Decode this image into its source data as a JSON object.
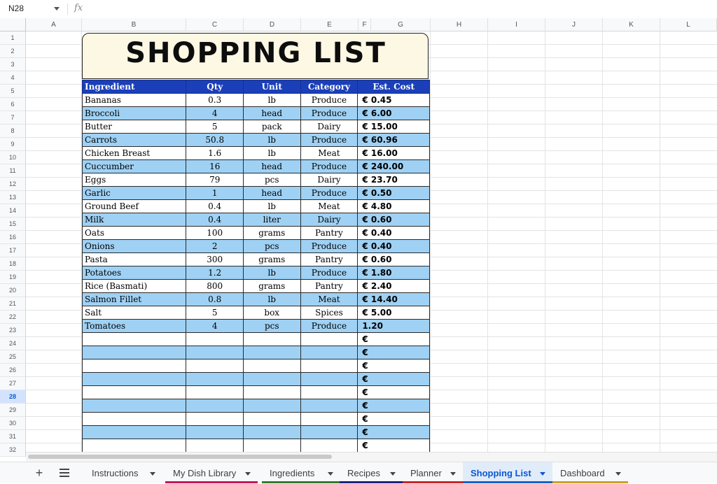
{
  "formula_bar": {
    "cell_ref": "N28",
    "fx": "fx"
  },
  "columns": [
    "A",
    "B",
    "C",
    "D",
    "E",
    "F",
    "G",
    "H",
    "I",
    "J",
    "K",
    "L"
  ],
  "rows": [
    "1",
    "2",
    "3",
    "4",
    "5",
    "6",
    "7",
    "8",
    "9",
    "10",
    "11",
    "12",
    "13",
    "14",
    "15",
    "16",
    "17",
    "18",
    "19",
    "20",
    "21",
    "22",
    "23",
    "24",
    "25",
    "26",
    "27",
    "28",
    "29",
    "30",
    "31",
    "32"
  ],
  "selected_row": "28",
  "title": "SHOPPING LIST",
  "table": {
    "headers": [
      "Ingredient",
      "Qty",
      "Unit",
      "Category",
      "Est. Cost"
    ],
    "items": [
      [
        "Bananas",
        "0.3",
        "lb",
        "Produce",
        "€ 0.45"
      ],
      [
        "Broccoli",
        "4",
        "head",
        "Produce",
        "€ 6.00"
      ],
      [
        "Butter",
        "5",
        "pack",
        "Dairy",
        "€ 15.00"
      ],
      [
        "Carrots",
        "50.8",
        "lb",
        "Produce",
        "€ 60.96"
      ],
      [
        "Chicken Breast",
        "1.6",
        "lb",
        "Meat",
        "€ 16.00"
      ],
      [
        "Cuccumber",
        "16",
        "head",
        "Produce",
        "€ 240.00"
      ],
      [
        "Eggs",
        "79",
        "pcs",
        "Dairy",
        "€ 23.70"
      ],
      [
        "Garlic",
        "1",
        "head",
        "Produce",
        "€ 0.50"
      ],
      [
        "Ground Beef",
        "0.4",
        "lb",
        "Meat",
        "€ 4.80"
      ],
      [
        "Milk",
        "0.4",
        "liter",
        "Dairy",
        "€ 0.60"
      ],
      [
        "Oats",
        "100",
        "grams",
        "Pantry",
        "€ 0.40"
      ],
      [
        "Onions",
        "2",
        "pcs",
        "Produce",
        "€ 0.40"
      ],
      [
        "Pasta",
        "300",
        "grams",
        "Pantry",
        "€ 0.60"
      ],
      [
        "Potatoes",
        "1.2",
        "lb",
        "Produce",
        "€ 1.80"
      ],
      [
        "Rice (Basmati)",
        "800",
        "grams",
        "Pantry",
        "€ 2.40"
      ],
      [
        "Salmon Fillet",
        "0.8",
        "lb",
        "Meat",
        "€ 14.40"
      ],
      [
        "Salt",
        "5",
        "box",
        "Spices",
        "€ 5.00"
      ],
      [
        "Tomatoes",
        "4",
        "pcs",
        "Produce",
        "1.20"
      ],
      [
        "",
        "",
        "",
        "",
        "€"
      ],
      [
        "",
        "",
        "",
        "",
        "€"
      ],
      [
        "",
        "",
        "",
        "",
        "€"
      ],
      [
        "",
        "",
        "",
        "",
        "€"
      ],
      [
        "",
        "",
        "",
        "",
        "€"
      ],
      [
        "",
        "",
        "",
        "",
        "€"
      ],
      [
        "",
        "",
        "",
        "",
        "€"
      ],
      [
        "",
        "",
        "",
        "",
        "€"
      ],
      [
        "",
        "",
        "",
        "",
        "€"
      ]
    ]
  },
  "tabs": [
    {
      "label": "Instructions",
      "color": ""
    },
    {
      "label": "My Dish Library",
      "color": "#c2185b"
    },
    {
      "label": "Ingredients",
      "color": "#2e7d32"
    },
    {
      "label": "Recipes",
      "color": "#1a237e"
    },
    {
      "label": "Planner",
      "color": "#c62828"
    },
    {
      "label": "Shopping List",
      "color": "#1565c0",
      "active": true
    },
    {
      "label": "Dashboard",
      "color": "#c9a227"
    }
  ],
  "colors": {
    "header_blue": "#1a3fb9",
    "band_blue": "#9fd1f4",
    "title_bg": "#fdf8e4"
  }
}
